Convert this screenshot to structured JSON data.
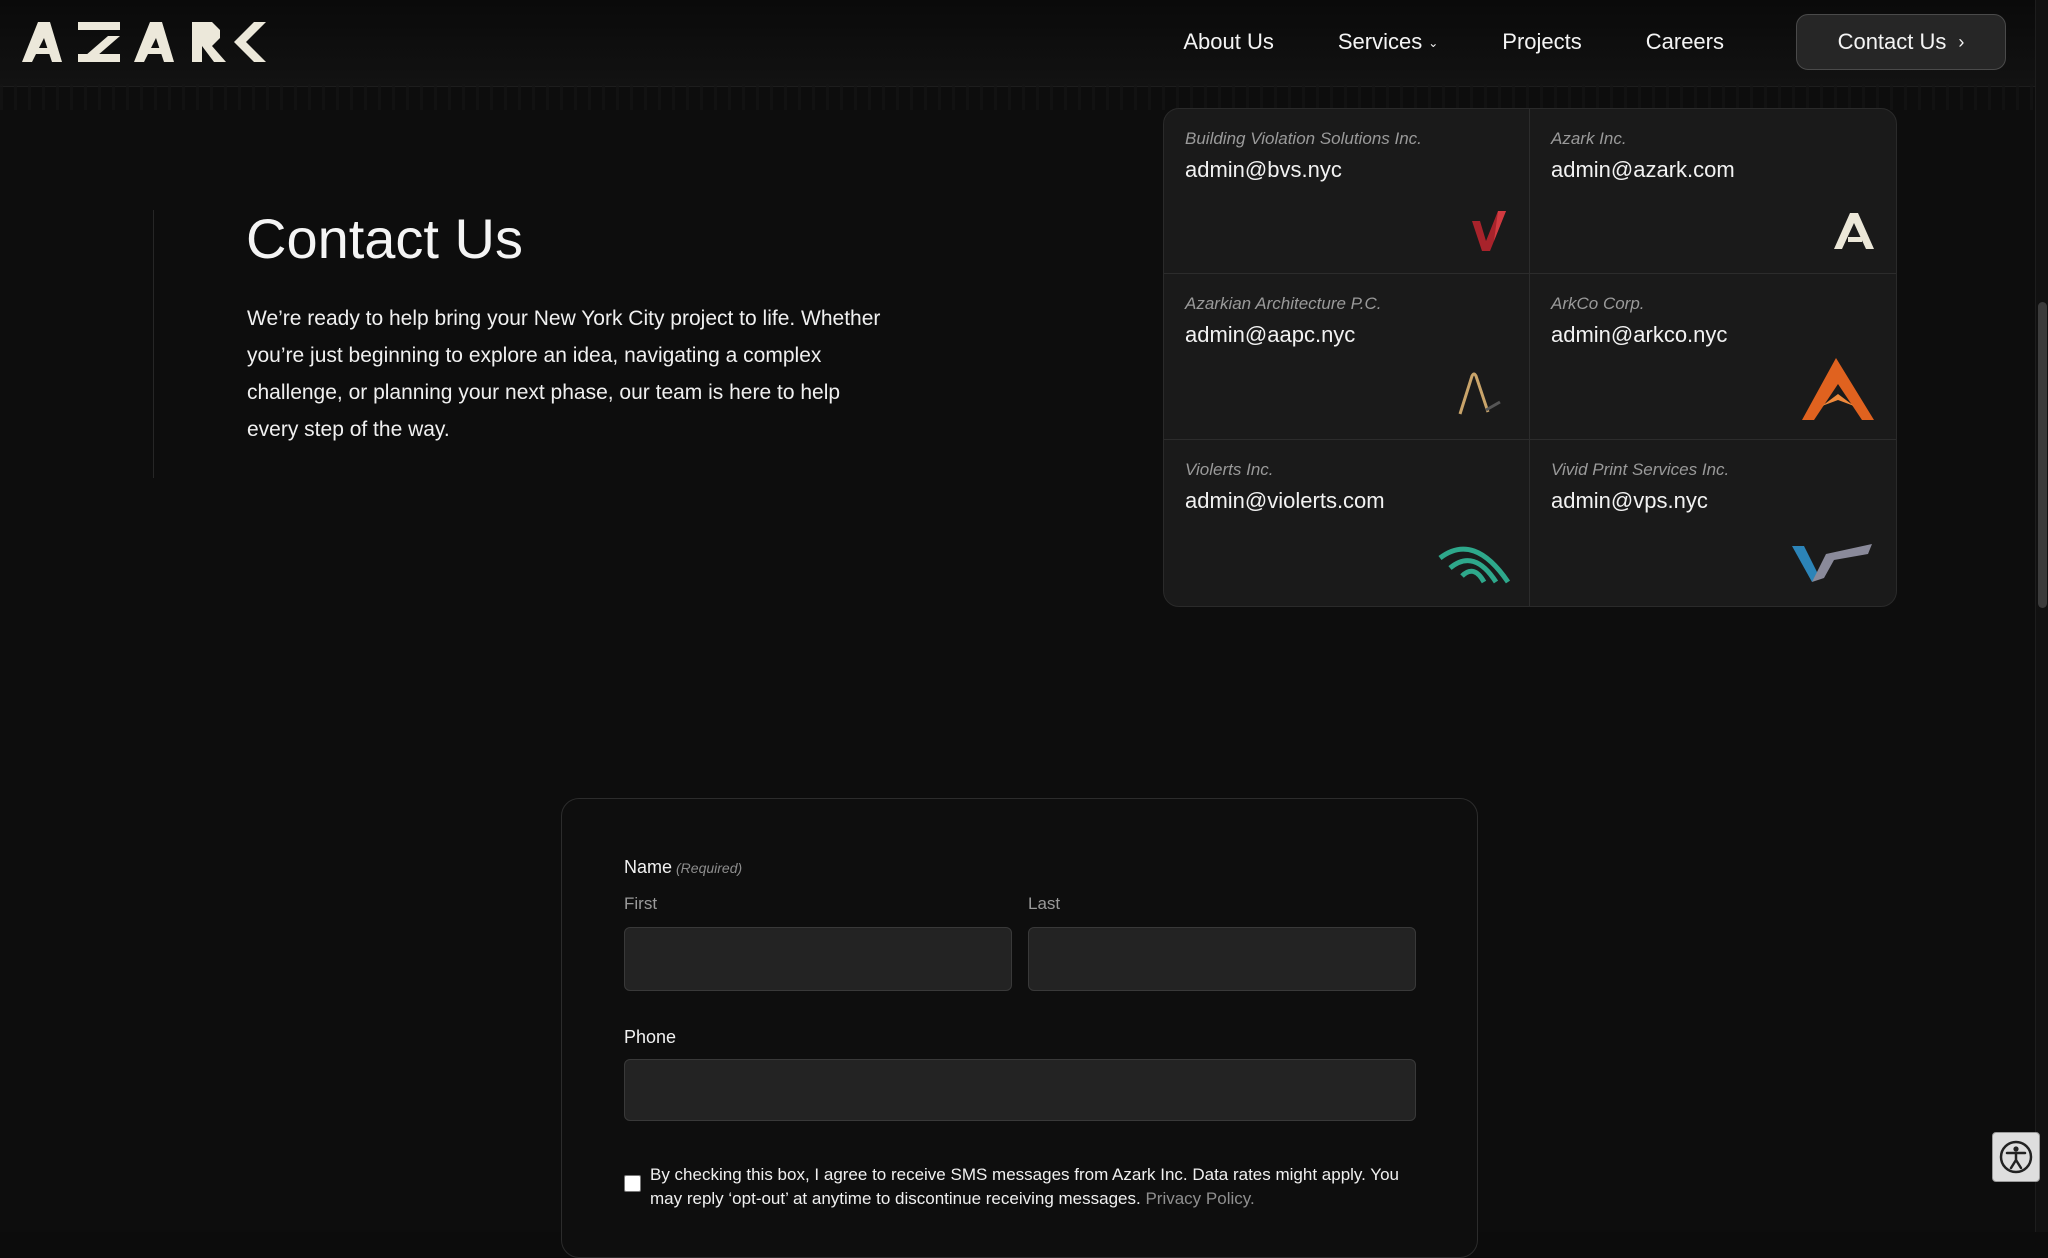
{
  "brand": {
    "logo_text": "AZARK"
  },
  "nav": {
    "items": [
      {
        "label": "About Us"
      },
      {
        "label": "Services"
      },
      {
        "label": "Projects"
      },
      {
        "label": "Careers"
      }
    ],
    "cta_label": "Contact Us"
  },
  "intro": {
    "title": "Contact Us",
    "body": "We’re ready to help bring your New York City project to life. Whether you’re just beginning to explore an idea, navigating a complex challenge, or planning your next phase, our team is here to help every step of the way."
  },
  "companies": [
    {
      "name": "Building Violation Solutions Inc.",
      "email": "admin@bvs.nyc",
      "logo_icon": "bvs-checkmark-logo-icon",
      "accent": "#b3262d"
    },
    {
      "name": "Azark Inc.",
      "email": "admin@azark.com",
      "logo_icon": "azark-a-logo-icon",
      "accent": "#e9e6d8"
    },
    {
      "name": "Azarkian Architecture P.C.",
      "email": "admin@aapc.nyc",
      "logo_icon": "aapc-lambda-logo-icon",
      "accent": "#c9a46a"
    },
    {
      "name": "ArkCo Corp.",
      "email": "admin@arkco.nyc",
      "logo_icon": "arkco-chevron-logo-icon",
      "accent": "#e0621f"
    },
    {
      "name": "Violerts Inc.",
      "email": "admin@violerts.com",
      "logo_icon": "violerts-signal-logo-icon",
      "accent": "#2ea88b"
    },
    {
      "name": "Vivid Print Services Inc.",
      "email": "admin@vps.nyc",
      "logo_icon": "vps-v-logo-icon",
      "accent": "#2c84b8"
    }
  ],
  "form": {
    "name_label": "Name",
    "required_text": "(Required)",
    "first_label": "First",
    "last_label": "Last",
    "first_value": "",
    "last_value": "",
    "phone_label": "Phone",
    "phone_value": "",
    "consent_checked": false,
    "consent_text": "By checking this box, I agree to receive SMS messages from Azark Inc. Data rates might apply. You may reply ‘opt-out’ at anytime to discontinue receiving messages.",
    "privacy_link": "Privacy Policy."
  },
  "accessibility": {
    "icon": "accessibility-icon"
  }
}
